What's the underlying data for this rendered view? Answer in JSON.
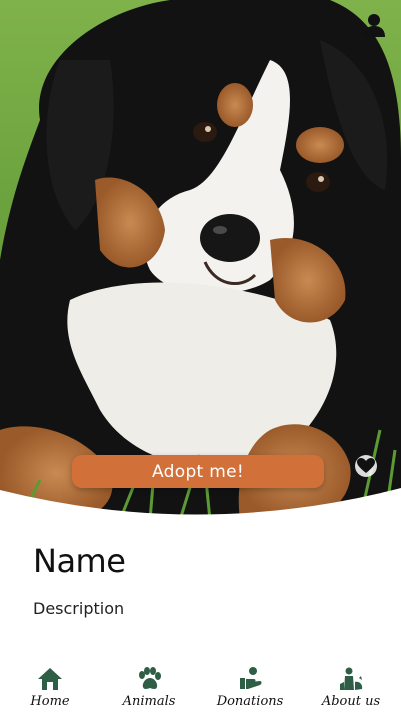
{
  "actions": {
    "adopt_label": "Adopt me!"
  },
  "pet": {
    "name": "Name",
    "description": "Description"
  },
  "nav": {
    "items": [
      {
        "label": "Home",
        "icon": "home-icon"
      },
      {
        "label": "Animals",
        "icon": "paw-icon"
      },
      {
        "label": "Donations",
        "icon": "donation-hand-icon"
      },
      {
        "label": "About us",
        "icon": "people-pets-icon"
      }
    ]
  },
  "colors": {
    "accent": "#d2703a",
    "nav_icon": "#2f5e46",
    "text": "#111111"
  }
}
